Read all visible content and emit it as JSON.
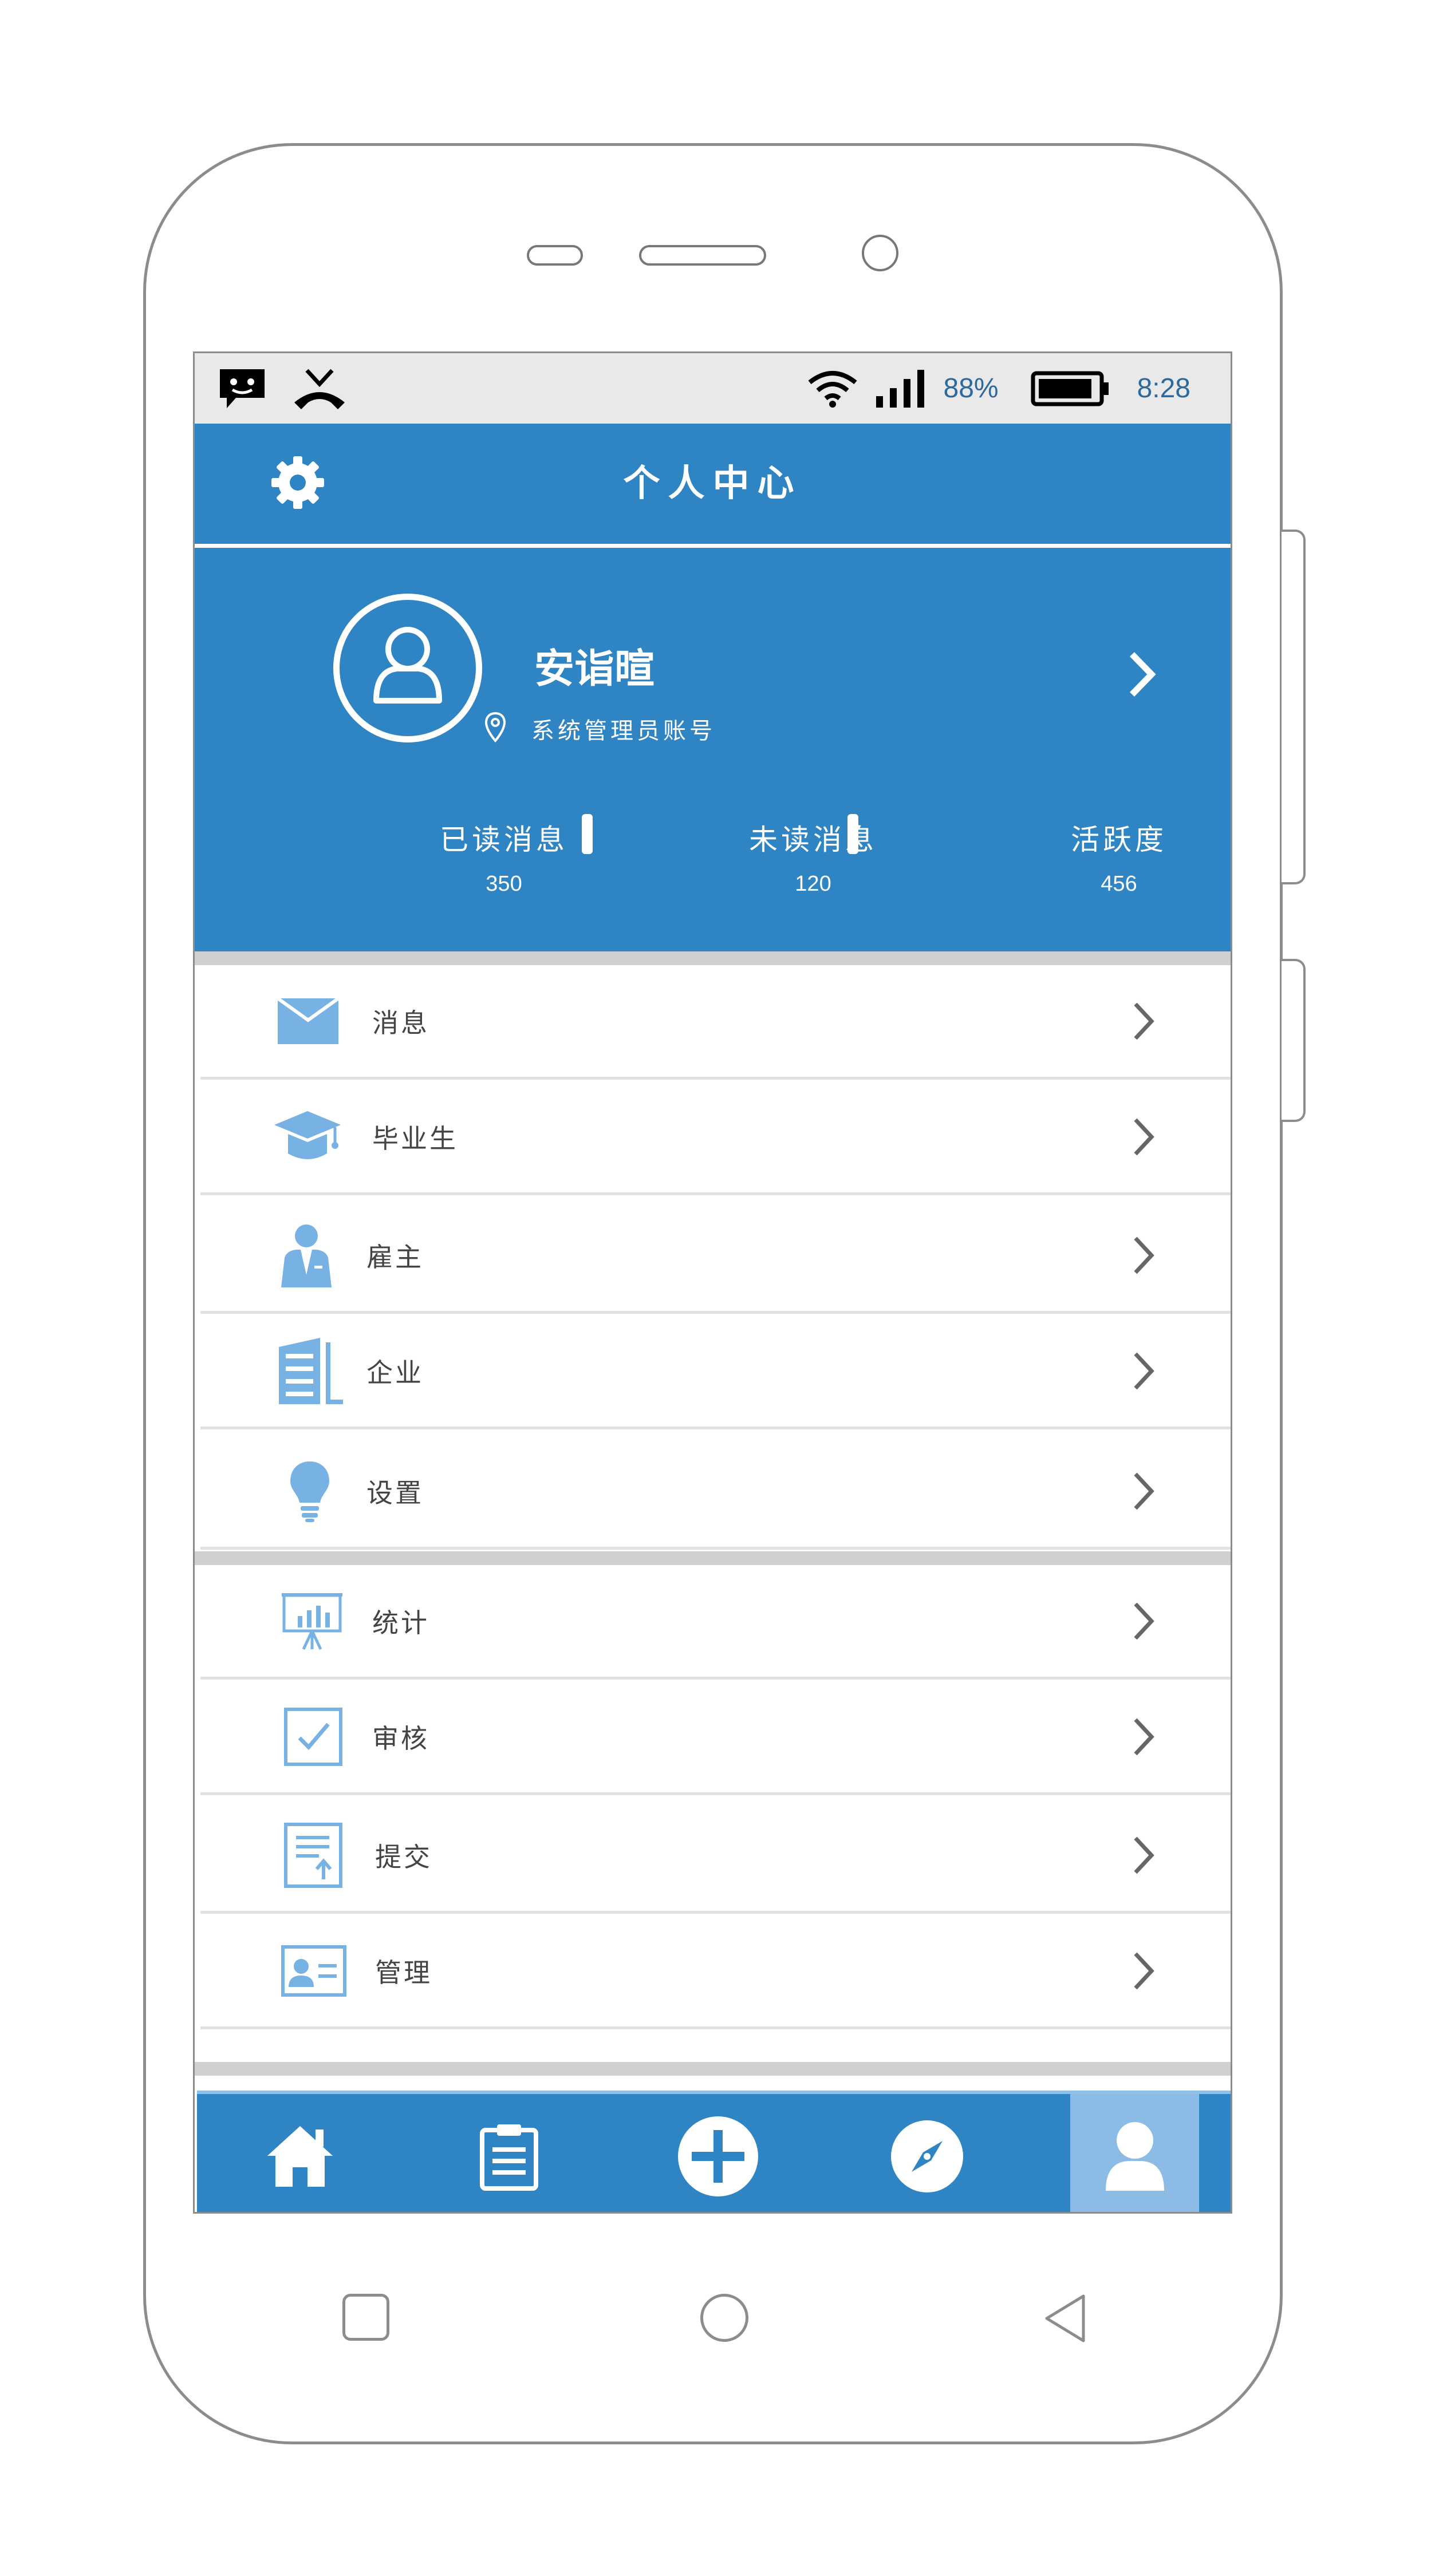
{
  "status_bar": {
    "battery_percent": "88%",
    "time": "8:28",
    "icons": [
      "message-icon",
      "missed-call-icon",
      "wifi-icon",
      "signal-icon",
      "battery-icon"
    ]
  },
  "header": {
    "title": "个人中心",
    "settings_icon": "gear-icon"
  },
  "profile": {
    "name": "安诣暄",
    "role": "系统管理员账号",
    "stats": [
      {
        "label": "已读消息",
        "value": "350"
      },
      {
        "label": "未读消息",
        "value": "120"
      },
      {
        "label": "活跃度",
        "value": "456"
      }
    ]
  },
  "menu_group_1": [
    {
      "label": "消息",
      "icon": "envelope-icon"
    },
    {
      "label": "毕业生",
      "icon": "graduation-cap-icon"
    },
    {
      "label": "雇主",
      "icon": "employer-icon"
    },
    {
      "label": "企业",
      "icon": "building-icon"
    },
    {
      "label": "设置",
      "icon": "lightbulb-icon"
    }
  ],
  "menu_group_2": [
    {
      "label": "统计",
      "icon": "presentation-chart-icon"
    },
    {
      "label": "审核",
      "icon": "checkbox-icon"
    },
    {
      "label": "提交",
      "icon": "document-upload-icon"
    },
    {
      "label": "管理",
      "icon": "id-card-icon"
    }
  ],
  "tab_bar": {
    "tabs": [
      "home-icon",
      "clipboard-icon",
      "plus-icon",
      "compass-icon",
      "user-icon"
    ],
    "active_index": 4
  },
  "colors": {
    "primary": "#2f84c3",
    "icon_light": "#78b2e4",
    "tab_active": "#8cbbe6",
    "divider": "#d0d0d2"
  }
}
